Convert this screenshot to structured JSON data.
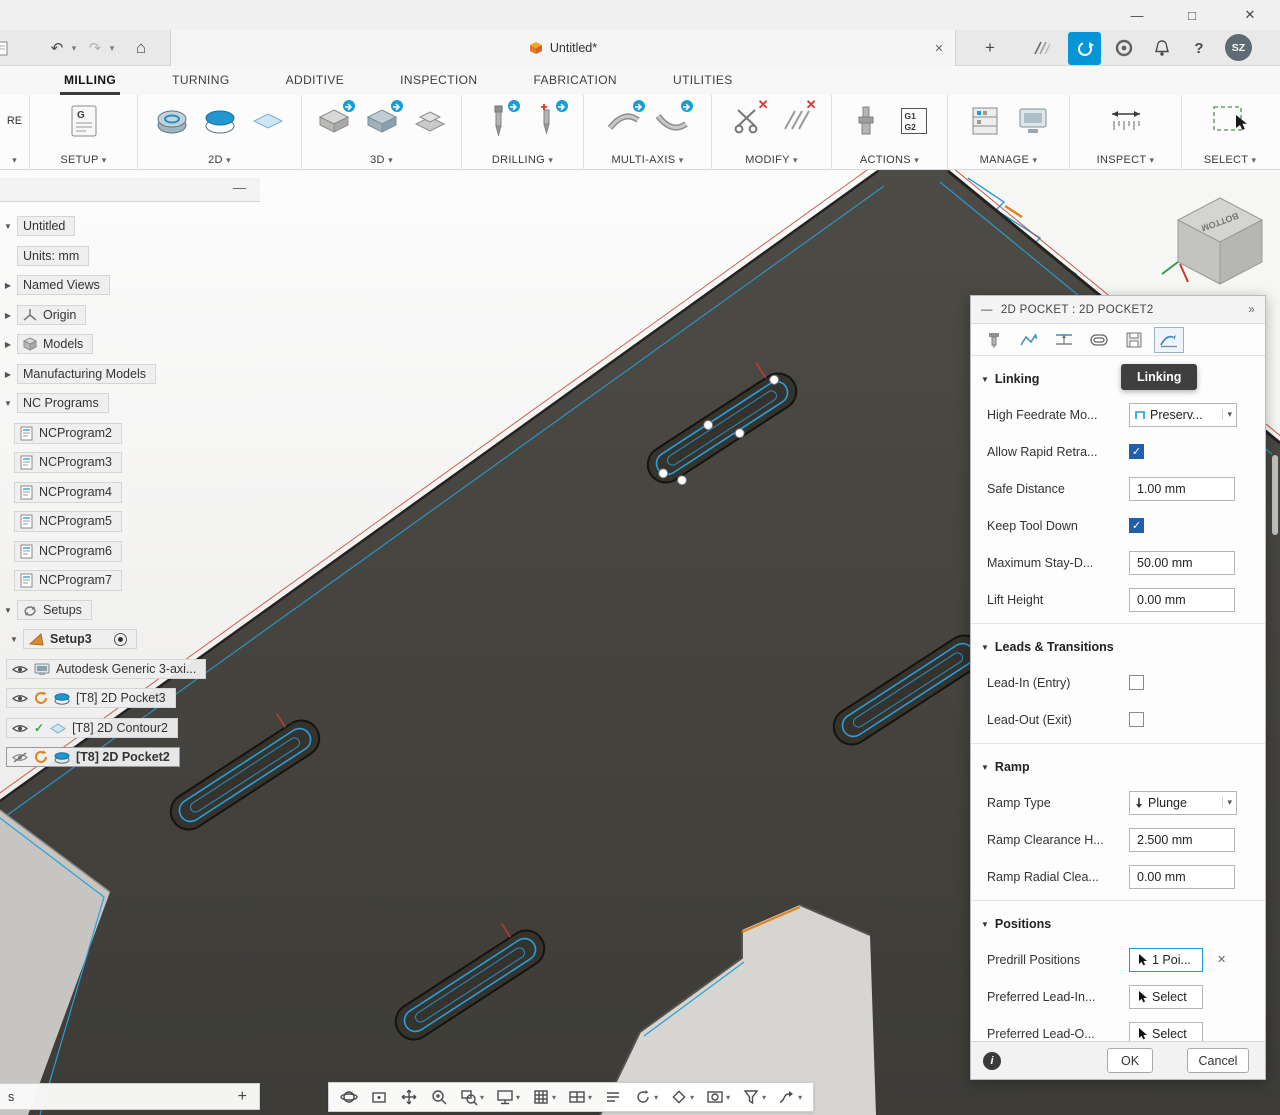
{
  "icons": {
    "caret": "▾",
    "expanded": "▼",
    "collapsed": "▶",
    "dash": "—"
  },
  "window": {
    "minimize": "—",
    "maximize": "□",
    "close": "✕"
  },
  "tabbar": {
    "undo": "↶",
    "redo": "↷",
    "home": "⌂",
    "new_tab": "+",
    "help": "?",
    "avatar": "SZ",
    "doc_tab": {
      "title": "Untitled*",
      "close": "✕"
    }
  },
  "ribbon_tabs": [
    {
      "label": "MILLING",
      "active": true
    },
    {
      "label": "TURNING"
    },
    {
      "label": "ADDITIVE"
    },
    {
      "label": "INSPECTION"
    },
    {
      "label": "FABRICATION"
    },
    {
      "label": "UTILITIES"
    }
  ],
  "toolbar": {
    "workspace_stub": "RE",
    "setup_icon_letter": "G",
    "g1": "G1",
    "g2": "G2",
    "groups": [
      {
        "label": "SETUP"
      },
      {
        "label": "2D"
      },
      {
        "label": "3D"
      },
      {
        "label": "DRILLING"
      },
      {
        "label": "MULTI-AXIS"
      },
      {
        "label": "MODIFY"
      },
      {
        "label": "ACTIONS"
      },
      {
        "label": "MANAGE"
      },
      {
        "label": "INSPECT"
      },
      {
        "label": "SELECT"
      }
    ]
  },
  "browser": {
    "collapse": "—",
    "items": [
      {
        "label": "Untitled"
      },
      {
        "label": "Units: mm"
      },
      {
        "label": "Named Views"
      },
      {
        "label": "Origin"
      },
      {
        "label": "Models"
      },
      {
        "label": "Manufacturing Models"
      },
      {
        "label": "NC Programs"
      },
      {
        "label": "NCProgram2"
      },
      {
        "label": "NCProgram3"
      },
      {
        "label": "NCProgram4"
      },
      {
        "label": "NCProgram5"
      },
      {
        "label": "NCProgram6"
      },
      {
        "label": "NCProgram7"
      },
      {
        "label": "Setups"
      },
      {
        "label": "Setup3"
      },
      {
        "label": "Autodesk Generic 3-axi..."
      },
      {
        "label": "[T8] 2D Pocket3"
      },
      {
        "label": "[T8] 2D Contour2"
      },
      {
        "label": "[T8] 2D Pocket2"
      }
    ],
    "footer": {
      "text": "s",
      "add": "+"
    }
  },
  "viewcube": {
    "face": "BOTTOM"
  },
  "dialog": {
    "title": "2D POCKET : 2D POCKET2",
    "collapse": "—",
    "expand": "»",
    "tooltip": "Linking",
    "section_linking": "Linking",
    "section_leads": "Leads & Transitions",
    "section_ramp": "Ramp",
    "section_positions": "Positions",
    "rows": {
      "high_feedrate": {
        "label": "High Feedrate Mo...",
        "value": "Preserv..."
      },
      "allow_rapid": {
        "label": "Allow Rapid Retra...",
        "check": "✓"
      },
      "safe_distance": {
        "label": "Safe Distance",
        "value": "1.00 mm"
      },
      "keep_tool_down": {
        "label": "Keep Tool Down",
        "check": "✓"
      },
      "max_stay_down": {
        "label": "Maximum Stay-D...",
        "value": "50.00 mm"
      },
      "lift_height": {
        "label": "Lift Height",
        "value": "0.00 mm"
      },
      "lead_in": {
        "label": "Lead-In (Entry)"
      },
      "lead_out": {
        "label": "Lead-Out (Exit)"
      },
      "ramp_type": {
        "label": "Ramp Type",
        "value": "Plunge"
      },
      "ramp_clearance": {
        "label": "Ramp Clearance H...",
        "value": "2.500 mm"
      },
      "ramp_radial": {
        "label": "Ramp Radial Clea...",
        "value": "0.00 mm"
      },
      "predrill": {
        "label": "Predrill Positions",
        "value": "1 Poi...",
        "clear": "✕"
      },
      "preferred_lead_in": {
        "label": "Preferred Lead-In...",
        "value": "Select"
      },
      "preferred_lead_out": {
        "label": "Preferred Lead-O...",
        "value": "Select"
      }
    },
    "footer": {
      "info": "i",
      "ok": "OK",
      "cancel": "Cancel"
    }
  },
  "navbar": {
    "items": [
      "orbit",
      "look-at",
      "pan",
      "zoom",
      "zoom-window",
      "display-settings",
      "grid-display",
      "viewports",
      "visual-style",
      "refresh",
      "effects",
      "capture",
      "selection-filter",
      "toolpath-display"
    ]
  },
  "colors": {
    "accent": "#0696d7",
    "toolpath_blue": "#2a9fd8",
    "part_dark": "#45443f",
    "warning_orange": "#e0841f",
    "success_green": "#43a047"
  }
}
